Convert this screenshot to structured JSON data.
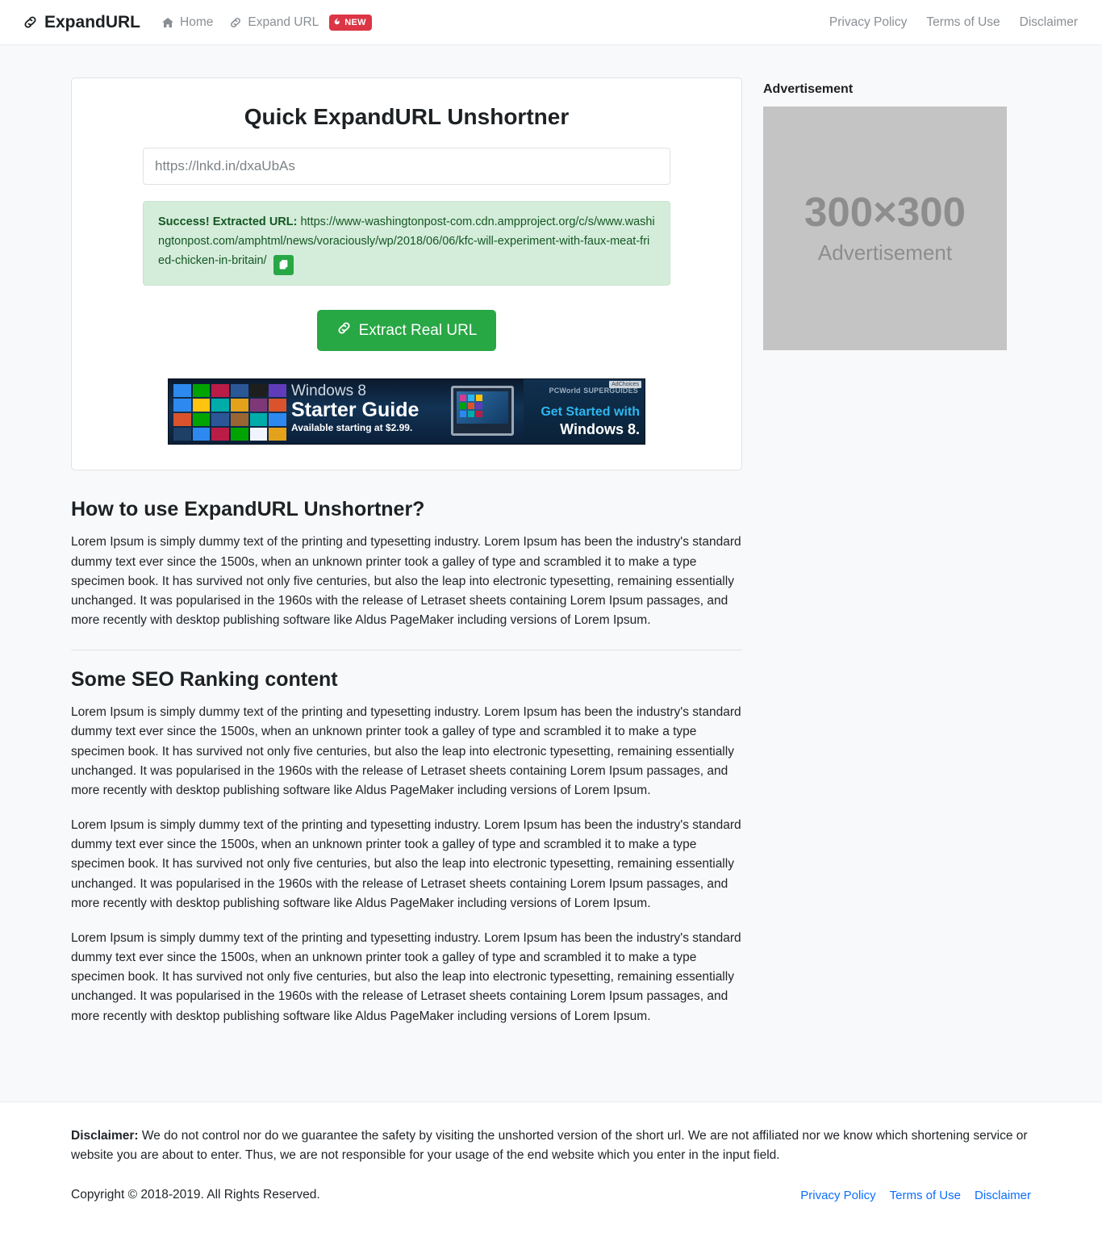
{
  "navbar": {
    "brand": "ExpandURL",
    "brand_icon": "link-icon",
    "left_links": [
      {
        "label": "Home",
        "icon": "home-icon"
      },
      {
        "label": "Expand URL",
        "icon": "link-icon",
        "badge": "NEW",
        "badge_icon": "fire-icon"
      }
    ],
    "right_links": [
      {
        "label": "Privacy Policy"
      },
      {
        "label": "Terms of Use"
      },
      {
        "label": "Disclaimer"
      }
    ]
  },
  "card": {
    "title": "Quick ExpandURL Unshortner",
    "input_value": "https://lnkd.in/dxaUbAs",
    "input_placeholder": "https://lnkd.in/dxaUbAs",
    "alert": {
      "prefix": "Success! Extracted URL:",
      "url": "https://www-washingtonpost-com.cdn.ampproject.org/c/s/www.washingtonpost.com/amphtml/news/voraciously/wp/2018/06/06/kfc-will-experiment-with-faux-meat-fried-chicken-in-britain/",
      "copy_icon": "copy-icon",
      "bg_color": "#d4edda",
      "text_color": "#155724"
    },
    "submit_label": "Extract Real URL",
    "submit_icon": "link-icon",
    "submit_color": "#28a745"
  },
  "banner_ad": {
    "headline_small": "Windows 8",
    "headline_big": "Starter Guide",
    "price_line": "Available starting at $2.99.",
    "publisher": "PCWorld",
    "publisher_sub": "SUPERGUIDES",
    "cta_line1": "Get Started with",
    "cta_line2": "Windows 8.",
    "adchoices": "AdChoices"
  },
  "sidebar": {
    "ad_label": "Advertisement",
    "ad_size": "300×300",
    "ad_sub": "Advertisement"
  },
  "content": {
    "sections": [
      {
        "heading": "How to use ExpandURL Unshortner?",
        "paragraphs": [
          "Lorem Ipsum is simply dummy text of the printing and typesetting industry. Lorem Ipsum has been the industry's standard dummy text ever since the 1500s, when an unknown printer took a galley of type and scrambled it to make a type specimen book. It has survived not only five centuries, but also the leap into electronic typesetting, remaining essentially unchanged. It was popularised in the 1960s with the release of Letraset sheets containing Lorem Ipsum passages, and more recently with desktop publishing software like Aldus PageMaker including versions of Lorem Ipsum."
        ]
      },
      {
        "heading": "Some SEO Ranking content",
        "paragraphs": [
          "Lorem Ipsum is simply dummy text of the printing and typesetting industry. Lorem Ipsum has been the industry's standard dummy text ever since the 1500s, when an unknown printer took a galley of type and scrambled it to make a type specimen book. It has survived not only five centuries, but also the leap into electronic typesetting, remaining essentially unchanged. It was popularised in the 1960s with the release of Letraset sheets containing Lorem Ipsum passages, and more recently with desktop publishing software like Aldus PageMaker including versions of Lorem Ipsum.",
          "Lorem Ipsum is simply dummy text of the printing and typesetting industry. Lorem Ipsum has been the industry's standard dummy text ever since the 1500s, when an unknown printer took a galley of type and scrambled it to make a type specimen book. It has survived not only five centuries, but also the leap into electronic typesetting, remaining essentially unchanged. It was popularised in the 1960s with the release of Letraset sheets containing Lorem Ipsum passages, and more recently with desktop publishing software like Aldus PageMaker including versions of Lorem Ipsum.",
          "Lorem Ipsum is simply dummy text of the printing and typesetting industry. Lorem Ipsum has been the industry's standard dummy text ever since the 1500s, when an unknown printer took a galley of type and scrambled it to make a type specimen book. It has survived not only five centuries, but also the leap into electronic typesetting, remaining essentially unchanged. It was popularised in the 1960s with the release of Letraset sheets containing Lorem Ipsum passages, and more recently with desktop publishing software like Aldus PageMaker including versions of Lorem Ipsum."
        ]
      }
    ]
  },
  "footer": {
    "disclaimer_label": "Disclaimer:",
    "disclaimer_text": " We do not control nor do we guarantee the safety by visiting the unshorted version of the short url. We are not affiliated nor we know which shortening service or website you are about to enter. Thus, we are not responsible for your usage of the end website which you enter in the input field.",
    "copyright": "Copyright © 2018-2019. All Rights Reserved.",
    "links": [
      {
        "label": "Privacy Policy"
      },
      {
        "label": "Terms of Use"
      },
      {
        "label": "Disclaimer"
      }
    ],
    "link_color": "#0d6efd"
  }
}
